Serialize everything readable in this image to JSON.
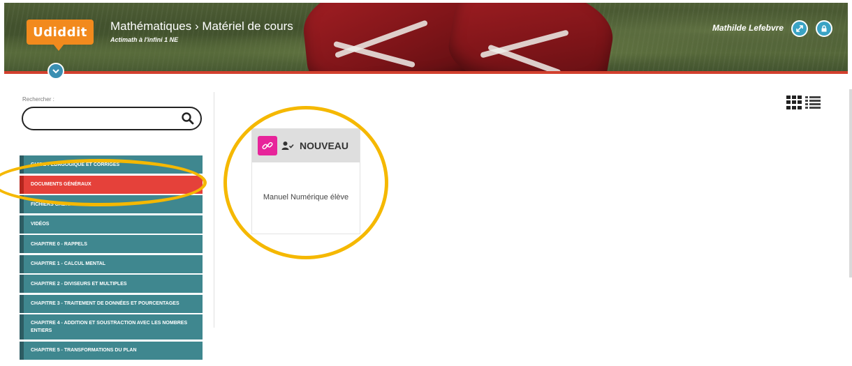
{
  "header": {
    "logo": "Udiddit",
    "breadcrumb": "Mathématiques › Matériel de cours",
    "subtitle": "Actimath à l'infini 1 NE",
    "user_name": "Mathilde Lefebvre"
  },
  "search": {
    "label": "Rechercher :",
    "value": "",
    "placeholder": ""
  },
  "sidebar": {
    "items": [
      {
        "label": "GUIDE PÉDAGOGIQUE ET CORRIGÉS",
        "active": false
      },
      {
        "label": "DOCUMENTS GÉNÉRAUX",
        "active": true
      },
      {
        "label": "FICHIERS CABRI",
        "active": false
      },
      {
        "label": "VIDÉOS",
        "active": false
      },
      {
        "label": "CHAPITRE 0 - RAPPELS",
        "active": false
      },
      {
        "label": "CHAPITRE 1 - CALCUL MENTAL",
        "active": false
      },
      {
        "label": "CHAPITRE 2 - DIVISEURS ET MULTIPLES",
        "active": false
      },
      {
        "label": "CHAPITRE 3 - TRAITEMENT DE DONNÉES ET POURCENTAGES",
        "active": false
      },
      {
        "label": "CHAPITRE 4 - ADDITION ET SOUSTRACTION AVEC LES NOMBRES ENTIERS",
        "active": false
      },
      {
        "label": "CHAPITRE 5 - TRANSFORMATIONS DU PLAN",
        "active": false
      }
    ]
  },
  "card": {
    "tag": "NOUVEAU",
    "title": "Manuel Numérique élève",
    "icon": "link-icon"
  },
  "colors": {
    "accent_orange": "#f28a1d",
    "nav_teal": "#3f878f",
    "nav_active": "#e5413a",
    "badge_pink": "#e7249a",
    "annotation_yellow": "#f5b800"
  }
}
